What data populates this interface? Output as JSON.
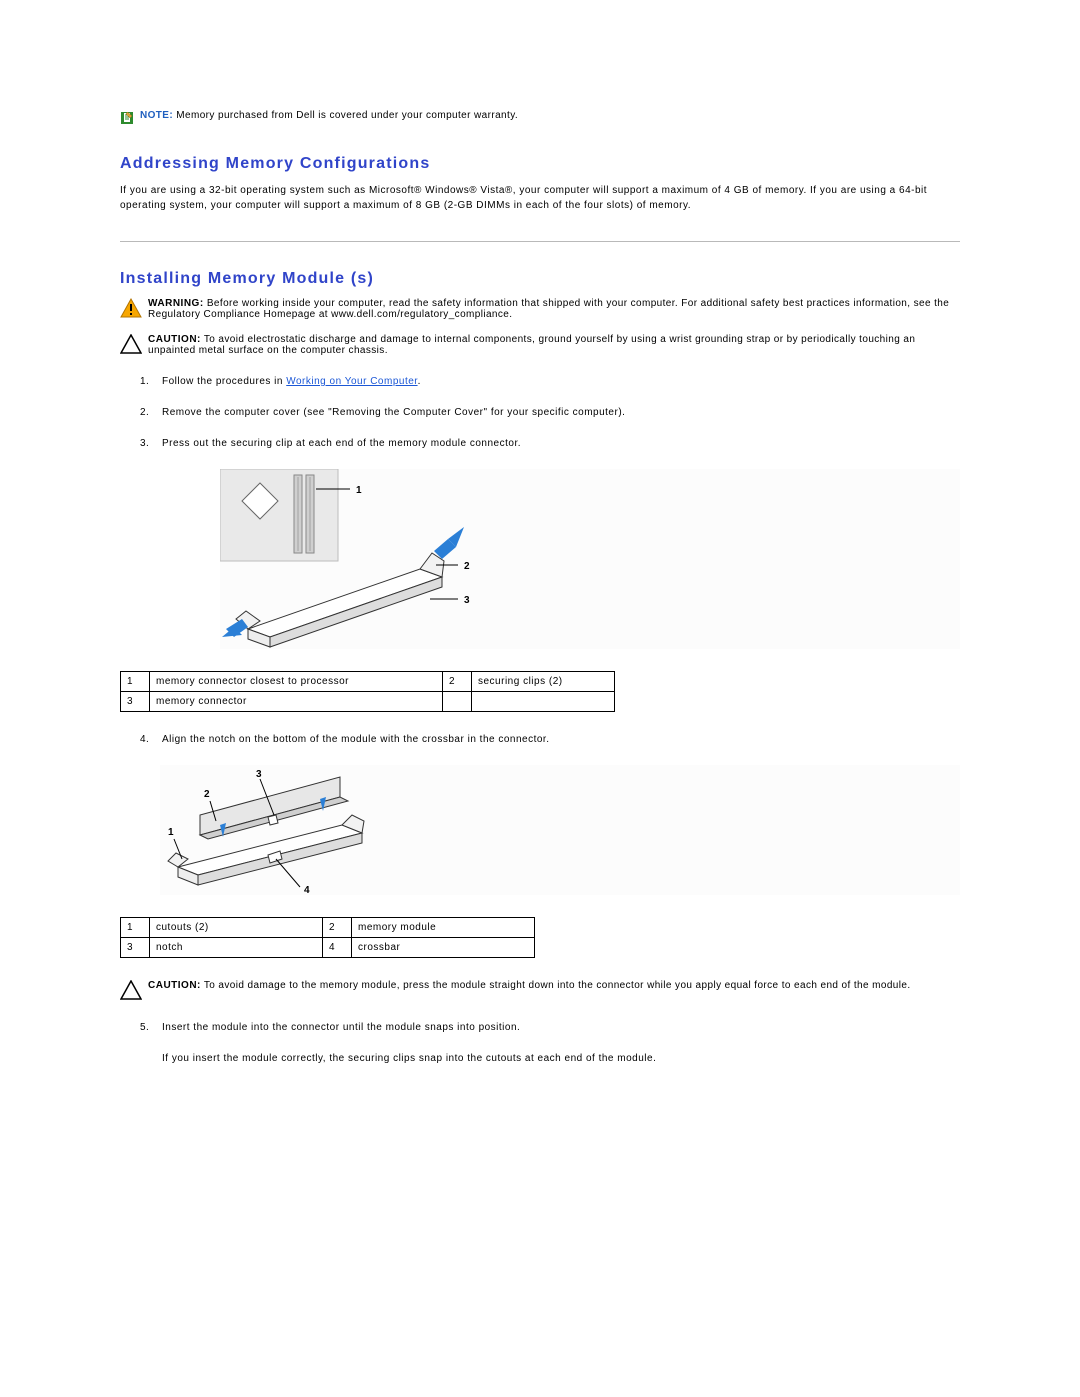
{
  "note": {
    "label": "NOTE:",
    "text": "Memory purchased from Dell is covered under your computer warranty."
  },
  "sec_addressing": {
    "title": "Addressing Memory Configurations",
    "body": "If you are using a 32-bit operating system such as Microsoft® Windows® Vista®, your computer will support a maximum of 4 GB of memory. If you are using a 64-bit operating system, your computer will support a maximum of 8 GB (2-GB DIMMs in each of the four slots) of memory."
  },
  "sec_install": {
    "title": "Installing Memory Module (s)"
  },
  "warning": {
    "label": "WARNING:",
    "text": "Before working inside your computer, read the safety information that shipped with your computer. For additional safety best practices information, see the Regulatory Compliance Homepage at www.dell.com/regulatory_compliance."
  },
  "caution1": {
    "label": "CAUTION:",
    "text": "To avoid electrostatic discharge and damage to internal components, ground yourself by using a wrist grounding strap or by periodically touching an unpainted metal surface on the computer chassis."
  },
  "steps": {
    "s1_pre": "Follow the procedures in ",
    "s1_link": "Working on Your Computer",
    "s1_post": ".",
    "s2": "Remove the computer cover (see \"Removing the Computer Cover\" for your specific computer).",
    "s3": "Press out the securing clip at each end of the memory module connector.",
    "s4": "Align the notch on the bottom of the module with the crossbar in the connector.",
    "s5": "Insert the module into the connector until the module snaps into position.",
    "s5b": "If you insert the module correctly, the securing clips snap into the cutouts at each end of the module."
  },
  "table1": {
    "c1n": "1",
    "c1": "memory connector closest to processor",
    "c2n": "2",
    "c2": "securing clips (2)",
    "c3n": "3",
    "c3": "memory connector",
    "c4n": "",
    "c4": ""
  },
  "table2": {
    "c1n": "1",
    "c1": "cutouts (2)",
    "c2n": "2",
    "c2": "memory module",
    "c3n": "3",
    "c3": "notch",
    "c4n": "4",
    "c4": "crossbar"
  },
  "caution2": {
    "label": "CAUTION:",
    "text": "To avoid damage to the memory module, press the module straight down into the connector while you apply equal force to each end of the module."
  },
  "dia1": {
    "l1": "1",
    "l2": "2",
    "l3": "3"
  },
  "dia2": {
    "l1": "1",
    "l2": "2",
    "l3": "3",
    "l4": "4"
  }
}
